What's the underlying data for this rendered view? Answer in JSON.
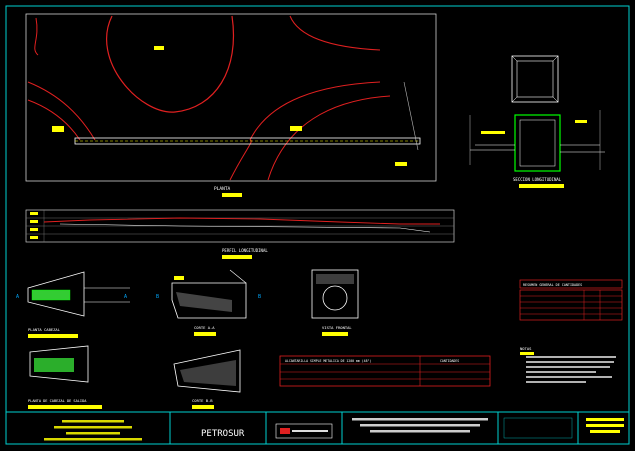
{
  "colors": {
    "background": "#000000",
    "frame": "#00d0d0",
    "road": "#e02020",
    "label_bg": "#ffff00",
    "text": "#ffffff",
    "dim": "#00ff00",
    "hatch": "#808080"
  },
  "drawing": {
    "company": "PETROSUR",
    "labels": {
      "planta": "PLANTA",
      "seccion": "SECCION LONGITUDINAL",
      "perfil": "PERFIL LONGITUDINAL",
      "planta_cabezal": "PLANTA CABEZAL",
      "corte_a": "CORTE A-A",
      "vista_frontal": "VISTA FRONTAL",
      "planta_cabezal_2": "PLANTA DE CABEZAL DE SALIDA",
      "corte_b": "CORTE B-B"
    },
    "table_resumen_title": "RESUMEN GENERAL DE CANTIDADES",
    "table_alcantarilla_title": "ALCANTARILLA SIMPLE METALICA DE 1200 mm (48\")",
    "table_cantidades_title": "CANTIDADES",
    "notes_title": "NOTAS"
  }
}
